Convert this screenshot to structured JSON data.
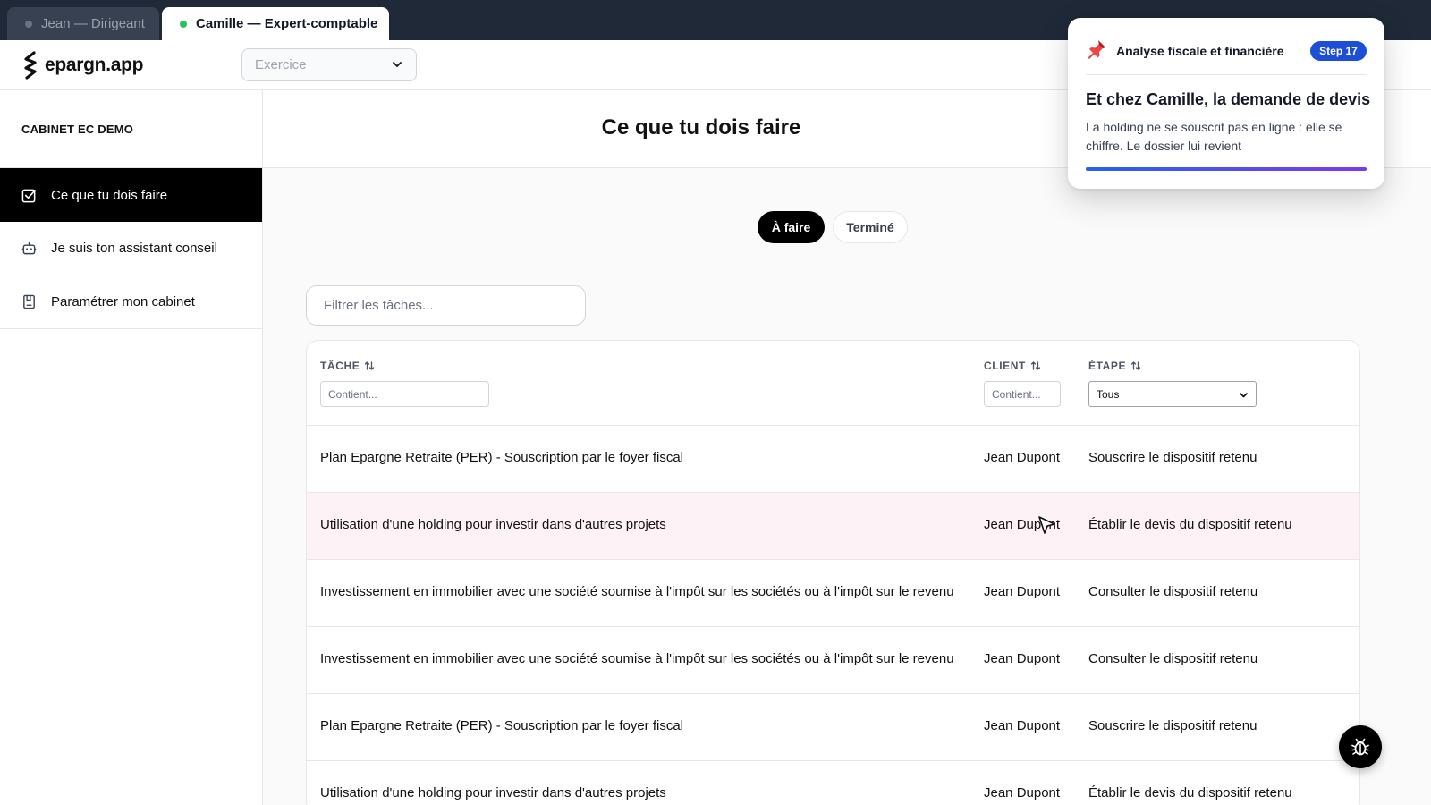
{
  "tabs": [
    {
      "label": "Jean — Dirigeant",
      "active": false
    },
    {
      "label": "Camille — Expert-comptable",
      "active": true
    }
  ],
  "header": {
    "logo_text": "epargn.app",
    "exercice_placeholder": "Exercice"
  },
  "sidebar": {
    "cabinet_name": "CABINET EC DEMO",
    "items": [
      {
        "label": "Ce que tu dois faire",
        "icon": "checkbox-icon",
        "active": true
      },
      {
        "label": "Je suis ton assistant conseil",
        "icon": "robot-icon",
        "active": false
      },
      {
        "label": "Paramétrer mon cabinet",
        "icon": "notebook-icon",
        "active": false
      }
    ]
  },
  "main": {
    "title": "Ce que tu dois faire",
    "status_toggle": {
      "todo": "À faire",
      "done": "Terminé",
      "selected": "À faire"
    },
    "filter_placeholder": "Filtrer les tâches...",
    "table": {
      "columns": [
        {
          "label": "TÂCHE",
          "filter_placeholder": "Contient..."
        },
        {
          "label": "CLIENT",
          "filter_placeholder": "Contient..."
        },
        {
          "label": "ÉTAPE",
          "filter_value": "Tous"
        }
      ],
      "rows": [
        {
          "task": "Plan Epargne Retraite (PER) - Souscription par le foyer fiscal",
          "client": "Jean Dupont",
          "step": "Souscrire le dispositif retenu",
          "highlighted": false
        },
        {
          "task": "Utilisation d'une holding pour investir dans d'autres projets",
          "client": "Jean Dupont",
          "step": "Établir le devis du dispositif retenu",
          "highlighted": true
        },
        {
          "task": "Investissement en immobilier avec une société soumise à l'impôt sur les sociétés ou à l'impôt sur le revenu",
          "client": "Jean Dupont",
          "step": "Consulter le dispositif retenu",
          "highlighted": false
        },
        {
          "task": "Investissement en immobilier avec une société soumise à l'impôt sur les sociétés ou à l'impôt sur le revenu",
          "client": "Jean Dupont",
          "step": "Consulter le dispositif retenu",
          "highlighted": false
        },
        {
          "task": "Plan Epargne Retraite (PER) - Souscription par le foyer fiscal",
          "client": "Jean Dupont",
          "step": "Souscrire le dispositif retenu",
          "highlighted": false
        },
        {
          "task": "Utilisation d'une holding pour investir dans d'autres projets",
          "client": "Jean Dupont",
          "step": "Établir le devis du dispositif retenu",
          "highlighted": false
        }
      ]
    }
  },
  "tour": {
    "section": "Analyse fiscale et financière",
    "step_badge": "Step 17",
    "title": "Et chez Camille, la demande de devis",
    "body": "La holding ne se souscrit pas en ligne : elle se chiffre. Le dossier lui revient",
    "progress": 1.0
  },
  "colors": {
    "tab_strip": "#1f2937",
    "accent_blue": "#1d4ed8",
    "active_dot": "#22c55e",
    "highlight_row": "#fdf2f6",
    "primary": "#000000"
  },
  "icons": {
    "fab": "bug-icon",
    "tour_pin": "pushpin-icon"
  }
}
